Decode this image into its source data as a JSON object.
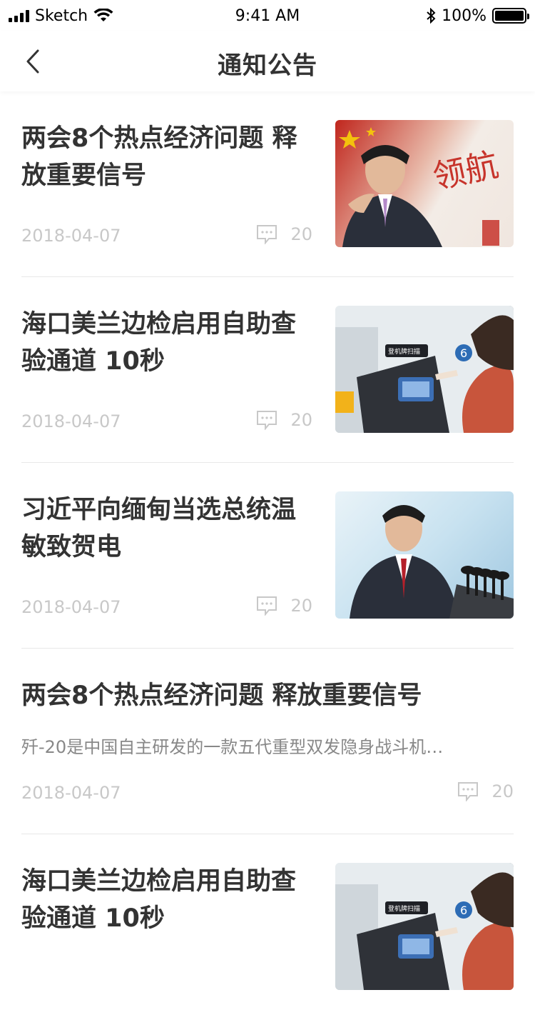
{
  "status_bar": {
    "carrier": "Sketch",
    "time": "9:41 AM",
    "battery": "100%"
  },
  "nav": {
    "title": "通知公告",
    "back_icon": "chevron-left-icon"
  },
  "items": [
    {
      "title": "两会8个热点经济问题 释放重要信号",
      "date": "2018-04-07",
      "comments": "20",
      "thumb_text": "领航"
    },
    {
      "title": "海口美兰边检启用自助查验通道 10秒",
      "date": "2018-04-07",
      "comments": "20",
      "thumb_text": "登机牌扫描"
    },
    {
      "title": "习近平向缅甸当选总统温敏致贺电",
      "date": "2018-04-07",
      "comments": "20"
    },
    {
      "title": "两会8个热点经济问题 释放重要信号",
      "summary": "歼-20是中国自主研发的一款五代重型双发隐身战斗机…",
      "date": "2018-04-07",
      "comments": "20"
    },
    {
      "title": "海口美兰边检启用自助查验通道 10秒",
      "thumb_text": "登机牌扫描"
    }
  ]
}
